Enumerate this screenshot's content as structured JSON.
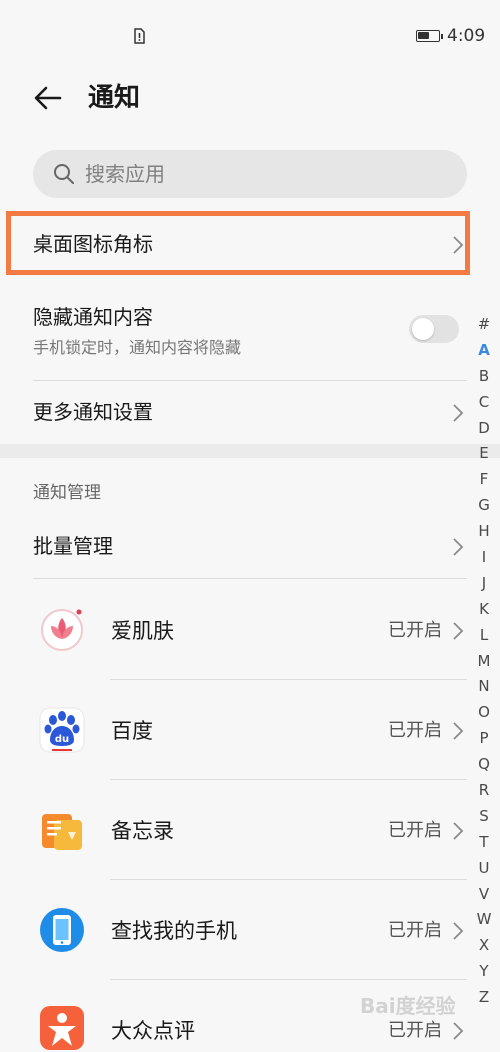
{
  "status_bar": {
    "time": "4:09",
    "battery_level": 0.6
  },
  "header": {
    "title": "通知"
  },
  "search": {
    "placeholder": "搜索应用"
  },
  "settings": {
    "desktop_badge": "桌面图标角标",
    "hide_content": {
      "title": "隐藏通知内容",
      "subtitle": "手机锁定时，通知内容将隐藏",
      "enabled": false
    },
    "more_settings": "更多通知设置"
  },
  "management": {
    "section_title": "通知管理",
    "batch": "批量管理",
    "apps": [
      {
        "name": "爱肌肤",
        "status": "已开启",
        "icon": "aijifu-lotus-icon"
      },
      {
        "name": "百度",
        "status": "已开启",
        "icon": "baidu-paw-icon"
      },
      {
        "name": "备忘录",
        "status": "已开启",
        "icon": "memo-icon"
      },
      {
        "name": "查找我的手机",
        "status": "已开启",
        "icon": "find-phone-icon"
      },
      {
        "name": "大众点评",
        "status": "已开启",
        "icon": "dianping-icon"
      }
    ]
  },
  "index_bar": [
    "#",
    "A",
    "B",
    "C",
    "D",
    "E",
    "F",
    "G",
    "H",
    "I",
    "J",
    "K",
    "L",
    "M",
    "N",
    "O",
    "P",
    "Q",
    "R",
    "S",
    "T",
    "U",
    "V",
    "W",
    "X",
    "Y",
    "Z"
  ],
  "index_active": "A",
  "watermark": "Bai度经验",
  "colors": {
    "highlight": "#f37b43",
    "index_active": "#3a8ae0"
  }
}
